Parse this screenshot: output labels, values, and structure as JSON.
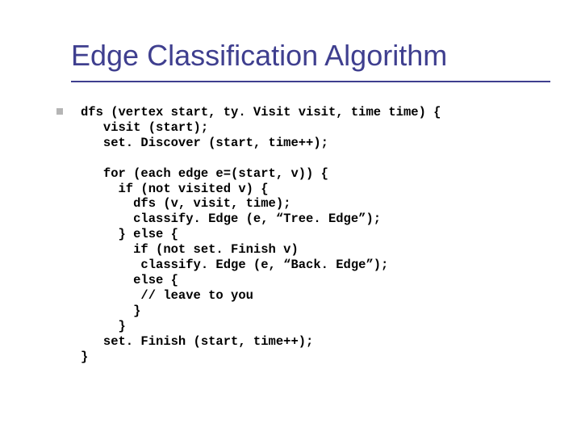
{
  "title": "Edge Classification Algorithm",
  "code": {
    "l1": "dfs (vertex start, ty. Visit visit, time time) {",
    "l2": "   visit (start);",
    "l3": "   set. Discover (start, time++);",
    "l4": "",
    "l5": "   for (each edge e=(start, v)) {",
    "l6": "     if (not visited v) {",
    "l7": "       dfs (v, visit, time);",
    "l8": "       classify. Edge (e, “Tree. Edge”);",
    "l9": "     } else {",
    "l10": "       if (not set. Finish v)",
    "l11": "        classify. Edge (e, “Back. Edge”);",
    "l12": "       else {",
    "l13": "        // leave to you",
    "l14": "       }",
    "l15": "     }",
    "l16": "   set. Finish (start, time++);",
    "l17": "}"
  }
}
